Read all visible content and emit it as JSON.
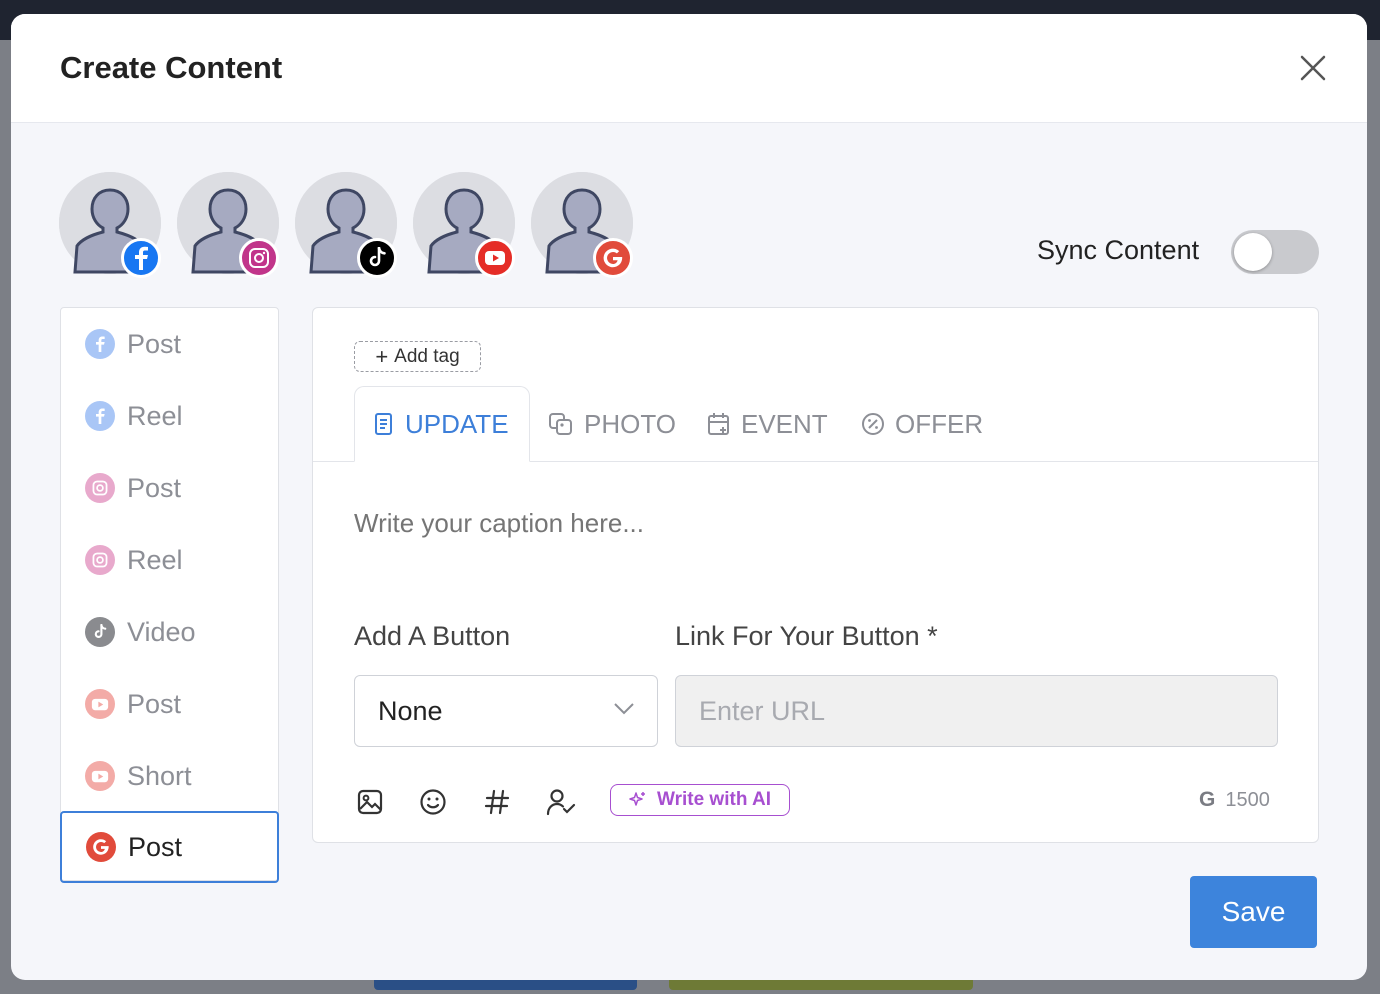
{
  "modal": {
    "title": "Create Content"
  },
  "accounts": [
    {
      "platform": "facebook",
      "icon": "facebook-icon",
      "color": "#1877f2"
    },
    {
      "platform": "instagram",
      "icon": "instagram-icon",
      "color": "#c1358a"
    },
    {
      "platform": "tiktok",
      "icon": "tiktok-icon",
      "color": "#000000"
    },
    {
      "platform": "youtube",
      "icon": "youtube-icon",
      "color": "#e52d27"
    },
    {
      "platform": "google",
      "icon": "google-icon",
      "color": "#e14b3b"
    }
  ],
  "sync": {
    "label": "Sync Content",
    "enabled": false
  },
  "sidebar": {
    "items": [
      {
        "label": "Post",
        "icon": "facebook-icon",
        "active": false
      },
      {
        "label": "Reel",
        "icon": "facebook-icon",
        "active": false
      },
      {
        "label": "Post",
        "icon": "instagram-icon",
        "active": false
      },
      {
        "label": "Reel",
        "icon": "instagram-icon",
        "active": false
      },
      {
        "label": "Video",
        "icon": "tiktok-icon",
        "active": false
      },
      {
        "label": "Post",
        "icon": "youtube-icon",
        "active": false
      },
      {
        "label": "Short",
        "icon": "youtube-icon",
        "active": false
      },
      {
        "label": "Post",
        "icon": "google-icon",
        "active": true
      }
    ]
  },
  "editor": {
    "add_tag": "Add tag",
    "tabs": [
      {
        "label": "UPDATE",
        "icon": "document-icon",
        "active": true
      },
      {
        "label": "PHOTO",
        "icon": "photo-icon",
        "active": false
      },
      {
        "label": "EVENT",
        "icon": "calendar-icon",
        "active": false
      },
      {
        "label": "OFFER",
        "icon": "offer-icon",
        "active": false
      }
    ],
    "caption_placeholder": "Write your caption here...",
    "button_label": "Add A Button",
    "button_value": "None",
    "link_label": "Link For Your Button *",
    "link_placeholder": "Enter URL",
    "ai_label": "Write with AI",
    "counter_prefix": "G",
    "counter": "1500"
  },
  "actions": {
    "save": "Save"
  },
  "colors": {
    "accent": "#3d84dc",
    "ai": "#a74fd0"
  }
}
